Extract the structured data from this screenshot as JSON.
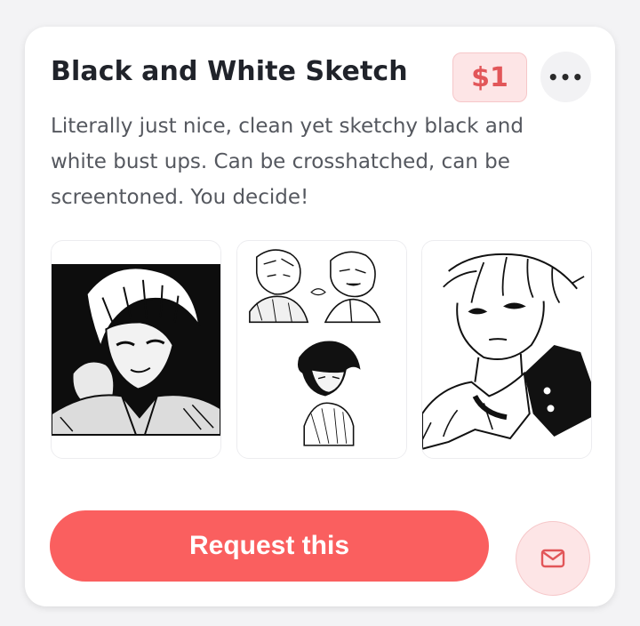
{
  "card": {
    "title": "Black and White Sketch",
    "price": "$1",
    "more_icon": "more-horizontal-icon",
    "more_glyph": "•••",
    "description": "Literally just nice, clean yet sketchy black and white bust ups. Can be crosshatched, can be screentoned. You decide!",
    "images": [
      {
        "name": "example-image-1"
      },
      {
        "name": "example-image-2"
      },
      {
        "name": "example-image-3"
      }
    ],
    "request_label": "Request this",
    "message_icon": "mail-icon"
  },
  "colors": {
    "accent": "#fa5f5f",
    "price_bg": "#fde5e6",
    "price_text": "#e25659",
    "title_text": "#20232a",
    "body_text": "#55585f"
  }
}
